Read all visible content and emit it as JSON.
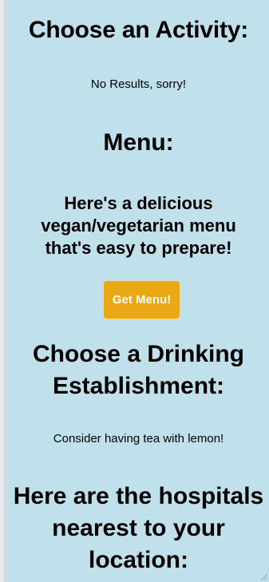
{
  "activity": {
    "heading": "Choose an Activity:",
    "no_results": "No Results, sorry!"
  },
  "menu": {
    "heading": "Menu:",
    "description": "Here's a delicious vegan/vegetarian menu that's easy to prepare!",
    "button_label": "Get Menu!",
    "button_color": "#eaa814"
  },
  "drinking": {
    "heading": "Choose a Drinking Establishment:",
    "suggestion": "Consider having tea with lemon!"
  },
  "hospitals": {
    "heading": "Here are the hospitals nearest to your location:"
  },
  "colors": {
    "panel_background": "#c0e0eb"
  }
}
